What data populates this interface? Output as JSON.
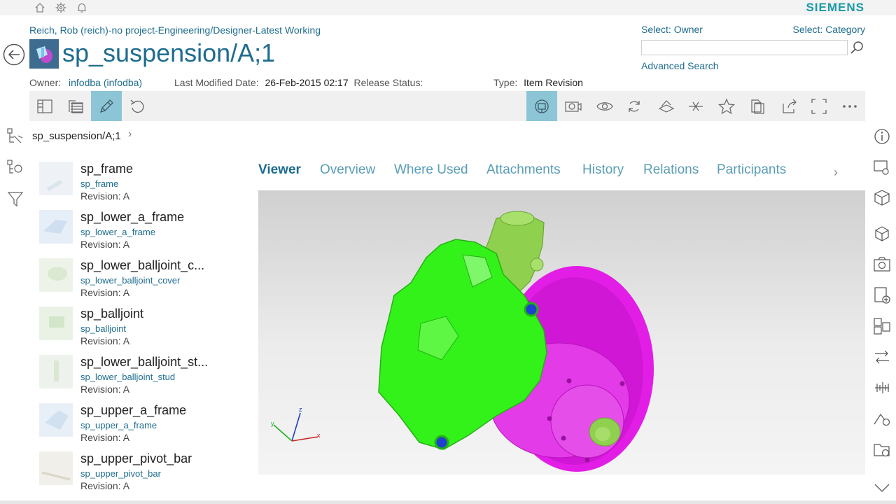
{
  "brand": "SIEMENS",
  "top_icons": [
    "home-icon",
    "gear-icon",
    "bell-icon"
  ],
  "header": {
    "context_path": "Reich, Rob (reich)-no project-Engineering/Designer-Latest Working",
    "title": "sp_suspension/A;1"
  },
  "meta": {
    "owner_label": "Owner:",
    "owner_value": "infodba (infodba)",
    "modified_label": "Last Modified Date:",
    "modified_value": "26-Feb-2015 02:17",
    "release_label": "Release Status:",
    "release_value": "",
    "type_label": "Type:",
    "type_value": "Item Revision"
  },
  "search": {
    "select_owner": "Select: Owner",
    "select_category": "Select: Category",
    "value": "",
    "placeholder": "",
    "advanced": "Advanced Search"
  },
  "breadcrumb": {
    "label": "sp_suspension/A;1"
  },
  "items": [
    {
      "name": "sp_frame",
      "sub": "sp_frame",
      "revision": "Revision:  A"
    },
    {
      "name": "sp_lower_a_frame",
      "sub": "sp_lower_a_frame",
      "revision": "Revision:  A"
    },
    {
      "name": "sp_lower_balljoint_c...",
      "sub": "sp_lower_balljoint_cover",
      "revision": "Revision:  A"
    },
    {
      "name": "sp_balljoint",
      "sub": "sp_balljoint",
      "revision": "Revision:  A"
    },
    {
      "name": "sp_lower_balljoint_st...",
      "sub": "sp_lower_balljoint_stud",
      "revision": "Revision:  A"
    },
    {
      "name": "sp_upper_a_frame",
      "sub": "sp_upper_a_frame",
      "revision": "Revision:  A"
    },
    {
      "name": "sp_upper_pivot_bar",
      "sub": "sp_upper_pivot_bar",
      "revision": "Revision:  A"
    }
  ],
  "tabs": [
    "Viewer",
    "Overview",
    "Where Used",
    "Attachments",
    "History",
    "Relations",
    "Participants"
  ],
  "active_tab": "Viewer",
  "viewer": {
    "axis_x": "x",
    "axis_y": "y",
    "axis_z": "z"
  },
  "colors": {
    "accent": "#1d6c8f",
    "brand": "#1a9aa6",
    "toolbar_active": "#8cc6d6",
    "part_green": "#33f21a",
    "part_magenta": "#e21ee6",
    "part_blue": "#1f3fd0",
    "part_olive": "#8fd14e"
  }
}
